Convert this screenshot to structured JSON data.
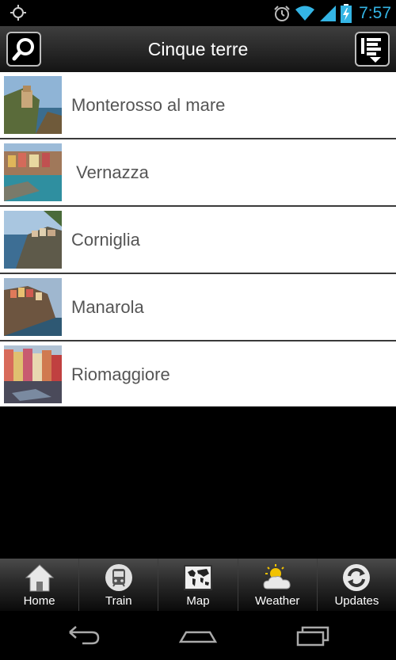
{
  "status_bar": {
    "time": "7:57",
    "icons": [
      "location-icon",
      "alarm-icon",
      "wifi-icon",
      "signal-icon",
      "battery-charging-icon"
    ],
    "time_color": "#34b5e5"
  },
  "action_bar": {
    "title": "Cinque terre",
    "search_icon": "search-icon",
    "sort_icon": "sort-list-icon"
  },
  "places": [
    {
      "name": "Monterosso al mare"
    },
    {
      "name": " Vernazza"
    },
    {
      "name": "Corniglia"
    },
    {
      "name": "Manarola"
    },
    {
      "name": "Riomaggiore"
    }
  ],
  "tabs": [
    {
      "label": "Home",
      "icon": "home-icon"
    },
    {
      "label": "Train",
      "icon": "train-icon"
    },
    {
      "label": "Map",
      "icon": "map-icon"
    },
    {
      "label": "Weather",
      "icon": "weather-icon"
    },
    {
      "label": "Updates",
      "icon": "updates-icon"
    }
  ],
  "nav_bar": {
    "icons": [
      "back-icon",
      "home-nav-icon",
      "recent-apps-icon"
    ]
  }
}
